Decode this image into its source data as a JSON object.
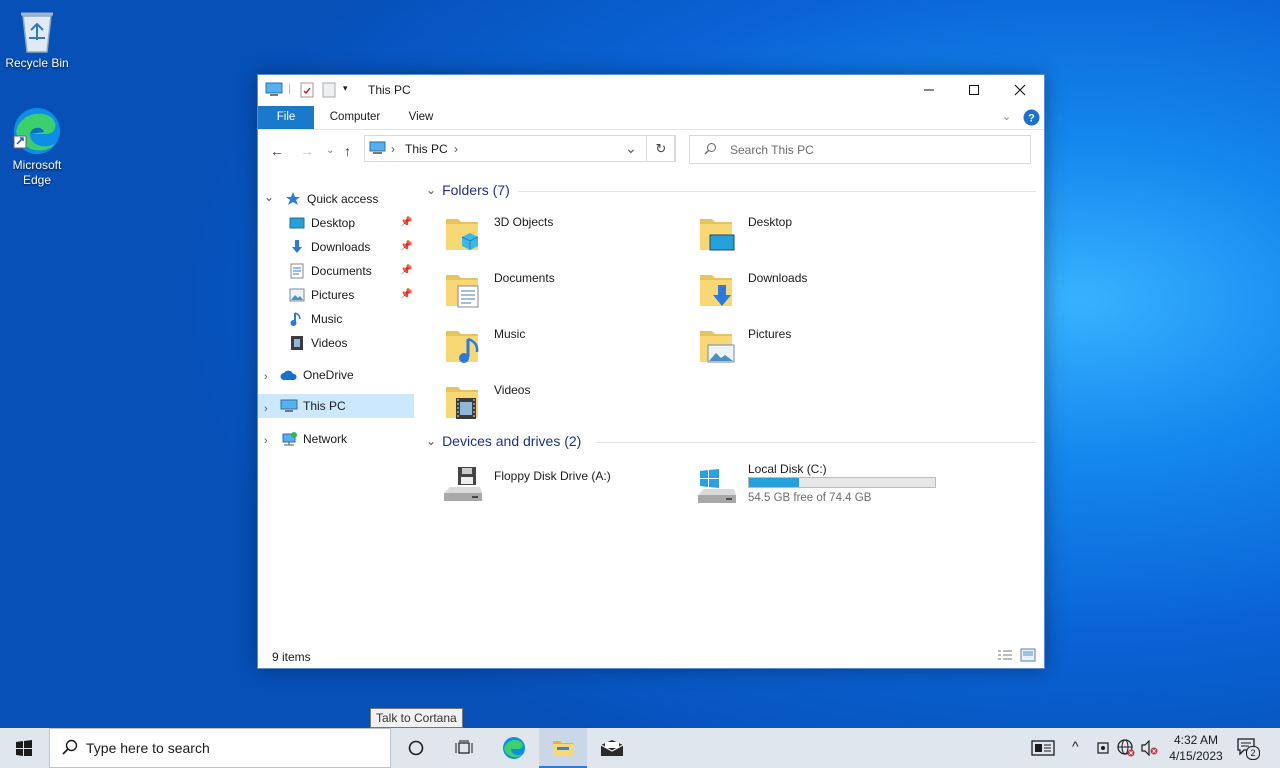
{
  "desktop": {
    "icons": [
      {
        "label_line1": "Recycle Bin",
        "label_line2": ""
      },
      {
        "label_line1": "Microsoft",
        "label_line2": "Edge"
      }
    ]
  },
  "window": {
    "title": "This PC",
    "ribbon": {
      "file": "File",
      "computer": "Computer",
      "view": "View"
    },
    "address": {
      "location": "This PC"
    },
    "search": {
      "placeholder": "Search This PC"
    },
    "nav": {
      "quick_access": "Quick access",
      "qa_items": [
        "Desktop",
        "Downloads",
        "Documents",
        "Pictures",
        "Music",
        "Videos"
      ],
      "onedrive": "OneDrive",
      "this_pc": "This PC",
      "network": "Network"
    },
    "folders_header": "Folders (7)",
    "folders": [
      "3D Objects",
      "Desktop",
      "Documents",
      "Downloads",
      "Music",
      "Pictures",
      "Videos"
    ],
    "devices_header": "Devices and drives (2)",
    "drives": [
      {
        "name": "Floppy Disk Drive (A:)"
      },
      {
        "name": "Local Disk (C:)",
        "free_text": "54.5 GB free of 74.4 GB",
        "used_fraction": 0.27
      }
    ],
    "status": "9 items"
  },
  "tooltip": "Talk to Cortana",
  "taskbar": {
    "search_placeholder": "Type here to search",
    "time": "4:32 AM",
    "date": "4/15/2023",
    "notification_count": "2"
  },
  "colors": {
    "accent": "#1979ca",
    "selection": "#cce8ff",
    "folder": "#f8d775",
    "drive_bar": "#26a0da"
  }
}
